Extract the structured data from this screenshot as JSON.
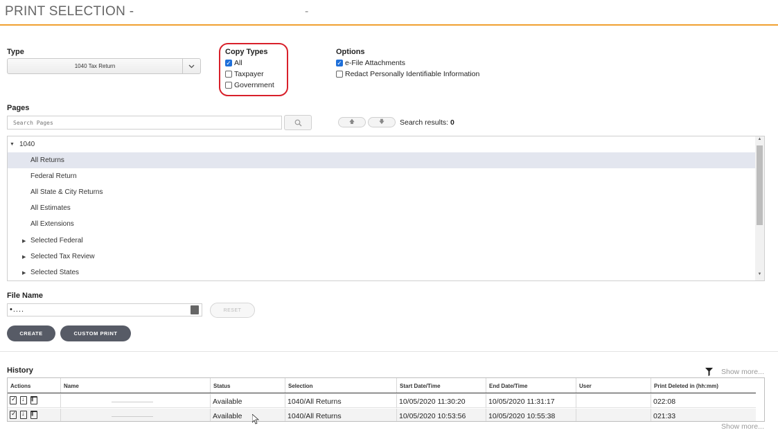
{
  "header": {
    "title": "PRINT SELECTION -",
    "title_suffix": "-"
  },
  "type_section": {
    "label": "Type",
    "selected": "1040 Tax Return"
  },
  "copy_types": {
    "label": "Copy Types",
    "options": [
      {
        "label": "All",
        "checked": true
      },
      {
        "label": "Taxpayer",
        "checked": false
      },
      {
        "label": "Government",
        "checked": false
      }
    ]
  },
  "options": {
    "label": "Options",
    "items": [
      {
        "label": "e-File Attachments",
        "checked": true
      },
      {
        "label": "Redact Personally Identifiable Information",
        "checked": false
      }
    ]
  },
  "pages": {
    "label": "Pages",
    "search_placeholder": "Search Pages",
    "search_results_label": "Search results:",
    "search_results_count": "0",
    "tree": {
      "root": "1040",
      "items": [
        {
          "label": "All Returns",
          "selected": true,
          "expandable": false
        },
        {
          "label": "Federal Return",
          "selected": false,
          "expandable": false
        },
        {
          "label": "All State & City Returns",
          "selected": false,
          "expandable": false
        },
        {
          "label": "All Estimates",
          "selected": false,
          "expandable": false
        },
        {
          "label": "All Extensions",
          "selected": false,
          "expandable": false
        },
        {
          "label": "Selected Federal",
          "selected": false,
          "expandable": true
        },
        {
          "label": "Selected Tax Review",
          "selected": false,
          "expandable": true
        },
        {
          "label": "Selected States",
          "selected": false,
          "expandable": true
        }
      ]
    }
  },
  "file_name": {
    "label": "File Name",
    "value": "•....",
    "reset_label": "RESET"
  },
  "buttons": {
    "create": "CREATE",
    "custom_print": "CUSTOM PRINT"
  },
  "history": {
    "label": "History",
    "show_more": "Show more...",
    "columns": [
      "Actions",
      "Name",
      "Status",
      "Selection",
      "Start Date/Time",
      "End Date/Time",
      "User",
      "Print Deleted in (hh:mm)"
    ],
    "rows": [
      {
        "name": "",
        "status": "Available",
        "selection": "1040/All Returns",
        "start": "10/05/2020 11:30:20",
        "end": "10/05/2020 11:31:17",
        "user": "",
        "deleted_in": "022:08"
      },
      {
        "name": "",
        "status": "Available",
        "selection": "1040/All Returns",
        "start": "10/05/2020 10:53:56",
        "end": "10/05/2020 10:55:38",
        "user": "",
        "deleted_in": "021:33"
      }
    ]
  },
  "icons": [
    "chevron-down-icon",
    "search-icon",
    "arrow-up-icon",
    "arrow-down-icon",
    "file-picker-icon",
    "filter-icon",
    "view-check-icon",
    "download-icon",
    "trash-icon"
  ],
  "colors": {
    "accent_line": "#f0a030",
    "highlight_circle": "#d8202a",
    "checkbox": "#1e6fd9",
    "dark_button": "#575b66",
    "selected_row": "#e3e6ef"
  }
}
